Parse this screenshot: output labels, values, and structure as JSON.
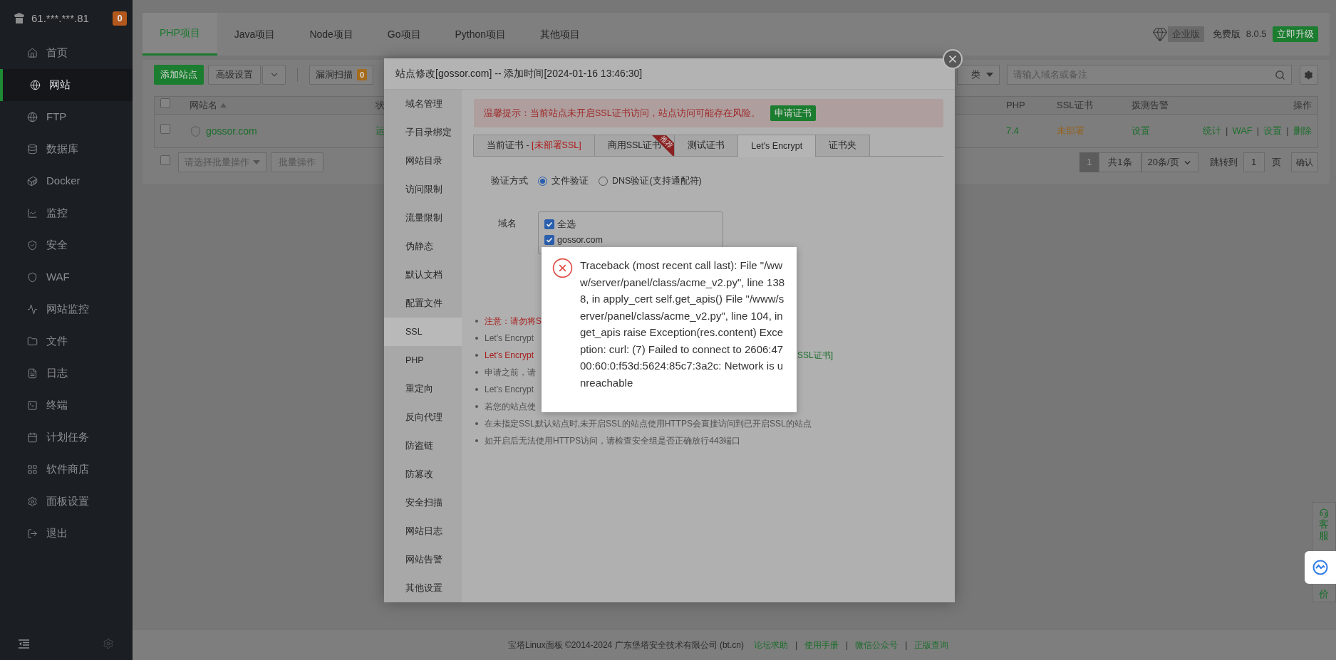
{
  "sidebar": {
    "host": "61.***.***.81",
    "badge": "0",
    "items": [
      {
        "label": "首页",
        "selected": false
      },
      {
        "label": "网站",
        "selected": true
      },
      {
        "label": "FTP",
        "selected": false
      },
      {
        "label": "数据库",
        "selected": false
      },
      {
        "label": "Docker",
        "selected": false
      },
      {
        "label": "监控",
        "selected": false
      },
      {
        "label": "安全",
        "selected": false
      },
      {
        "label": "WAF",
        "selected": false
      },
      {
        "label": "网站监控",
        "selected": false
      },
      {
        "label": "文件",
        "selected": false
      },
      {
        "label": "日志",
        "selected": false
      },
      {
        "label": "终端",
        "selected": false
      },
      {
        "label": "计划任务",
        "selected": false
      },
      {
        "label": "软件商店",
        "selected": false
      },
      {
        "label": "面板设置",
        "selected": false
      },
      {
        "label": "退出",
        "selected": false
      }
    ]
  },
  "top_tabs": [
    {
      "label": "PHP项目",
      "selected": true
    },
    {
      "label": "Java项目",
      "selected": false
    },
    {
      "label": "Node项目",
      "selected": false
    },
    {
      "label": "Go项目",
      "selected": false
    },
    {
      "label": "Python项目",
      "selected": false
    },
    {
      "label": "其他项目",
      "selected": false
    }
  ],
  "edition": {
    "badge": "企业版",
    "plan": "免费版",
    "version": "8.0.5",
    "upgrade": "立即升级"
  },
  "toolbar": {
    "add": "添加站点",
    "advanced": "高级设置",
    "scan": "漏洞扫描",
    "scan_count": "0",
    "category_fragment": "类",
    "search_placeholder": "请输入域名或备注"
  },
  "table": {
    "select_all_checked": false,
    "columns": [
      "网站名",
      "状",
      "PHP",
      "SSL证书",
      "拨测告警",
      "操作"
    ],
    "rows": [
      {
        "checked": false,
        "name": "gossor.com",
        "status_fragment": "运",
        "php": "7.4",
        "ssl": "未部署",
        "alert": "设置",
        "actions": [
          "统计",
          "WAF",
          "设置",
          "删除"
        ],
        "separator": "|"
      }
    ]
  },
  "batch": {
    "checked": false,
    "placeholder": "请选择批量操作",
    "button": "批量操作"
  },
  "pagination": {
    "pages": [
      {
        "label": "1",
        "selected": true
      }
    ],
    "total": "共1条",
    "page_size": "20条/页",
    "goto_label": "跳转到",
    "goto_value": "1",
    "page_unit": "页",
    "confirm": "确认"
  },
  "modal": {
    "title": "站点修改[gossor.com] -- 添加时间[2024-01-16 13:46:30]",
    "nav": [
      {
        "label": "域名管理",
        "selected": false
      },
      {
        "label": "子目录绑定",
        "selected": false
      },
      {
        "label": "网站目录",
        "selected": false
      },
      {
        "label": "访问限制",
        "selected": false
      },
      {
        "label": "流量限制",
        "selected": false
      },
      {
        "label": "伪静态",
        "selected": false
      },
      {
        "label": "默认文档",
        "selected": false
      },
      {
        "label": "配置文件",
        "selected": false
      },
      {
        "label": "SSL",
        "selected": true
      },
      {
        "label": "PHP",
        "selected": false
      },
      {
        "label": "重定向",
        "selected": false
      },
      {
        "label": "反向代理",
        "selected": false
      },
      {
        "label": "防盗链",
        "selected": false
      },
      {
        "label": "防篡改",
        "selected": false
      },
      {
        "label": "安全扫描",
        "selected": false
      },
      {
        "label": "网站日志",
        "selected": false
      },
      {
        "label": "网站告警",
        "selected": false
      },
      {
        "label": "其他设置",
        "selected": false
      }
    ],
    "alert": {
      "text": "温馨提示：当前站点未开启SSL证书访问，站点访问可能存在风险。",
      "button": "申请证书"
    },
    "tabs": [
      {
        "label": "当前证书 - ",
        "status": "[未部署SSL]",
        "selected": false
      },
      {
        "label": "商用SSL证书",
        "ribbon": "推荐",
        "selected": false
      },
      {
        "label": "测试证书",
        "selected": false
      },
      {
        "label": "Let's Encrypt",
        "selected": true
      },
      {
        "label": "证书夹",
        "selected": false
      }
    ],
    "verify": {
      "label": "验证方式",
      "options": [
        {
          "label": "文件验证",
          "selected": true
        },
        {
          "label": "DNS验证(支持通配符)",
          "selected": false
        }
      ]
    },
    "domains": {
      "label": "域名",
      "items": [
        {
          "label": "全选",
          "checked": true
        },
        {
          "label": "gossor.com",
          "checked": true
        }
      ]
    },
    "notes": [
      {
        "kind": "warning",
        "text": "注意：请勿将S"
      },
      {
        "kind": "normal",
        "text": "Let's Encrypt"
      },
      {
        "kind": "warning",
        "text": "Let's Encrypt",
        "tail": "SSL证书]"
      },
      {
        "kind": "normal",
        "text": "申请之前，请"
      },
      {
        "kind": "normal",
        "text": "Let's Encrypt"
      },
      {
        "kind": "normal",
        "text": "若您的站点使"
      },
      {
        "kind": "normal",
        "text": "在未指定SSL默认站点时,未开启SSL的站点使用HTTPS会直接访问到已开启SSL的站点"
      },
      {
        "kind": "normal",
        "text": "如开启后无法使用HTTPS访问，请检查安全组是否正确放行443端口"
      }
    ]
  },
  "error": {
    "message": "Traceback (most recent call last): File \"/www/server/panel/class/acme_v2.py\", line 1388, in apply_cert self.get_apis() File \"/www/server/panel/class/acme_v2.py\", line 104, in get_apis raise Exception(res.content) Exception: curl: (7) Failed to connect to 2606:4700:60:0:f53d:5624:85c7:3a2c: Network is unreachable"
  },
  "float_widget": {
    "top": "客服",
    "bottom": "价"
  },
  "footer": {
    "copyright": "宝塔Linux面板 ©2014-2024 广东堡塔安全技术有限公司 (bt.cn)",
    "links": [
      "论坛求助",
      "使用手册",
      "微信公众号",
      "正版查询"
    ],
    "separator": "|"
  }
}
